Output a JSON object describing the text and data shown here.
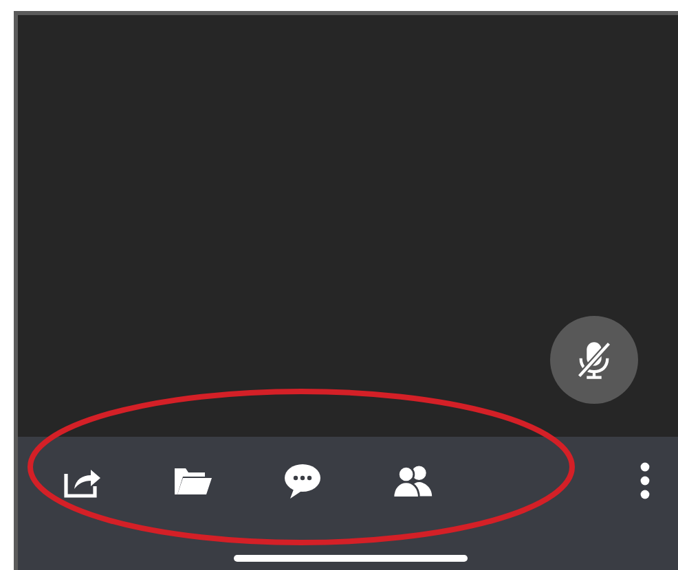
{
  "video": {
    "mic": {
      "muted": true
    }
  },
  "toolbar": {
    "items": [
      {
        "kind": "share"
      },
      {
        "kind": "files"
      },
      {
        "kind": "chat"
      },
      {
        "kind": "participants"
      },
      {
        "kind": "more"
      }
    ]
  },
  "annotations": [
    {
      "kind": "ellipse"
    }
  ]
}
